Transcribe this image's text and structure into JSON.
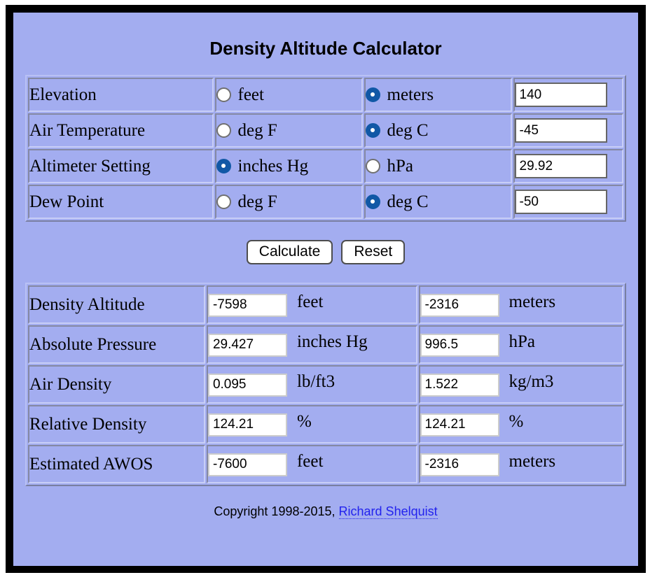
{
  "page": {
    "title": "Density Altitude Calculator",
    "background_color": "#a3adf0",
    "frame_color": "#000000",
    "accent_color": "#1158a6",
    "link_color": "#2222ee"
  },
  "inputs": {
    "rows": [
      {
        "label": "Elevation",
        "option_a": {
          "label": "feet",
          "selected": false
        },
        "option_b": {
          "label": "meters",
          "selected": true
        },
        "value": "140"
      },
      {
        "label": "Air Temperature",
        "option_a": {
          "label": "deg F",
          "selected": false
        },
        "option_b": {
          "label": "deg C",
          "selected": true
        },
        "value": "-45"
      },
      {
        "label": "Altimeter Setting",
        "option_a": {
          "label": "inches Hg",
          "selected": true
        },
        "option_b": {
          "label": "hPa",
          "selected": false
        },
        "value": "29.92"
      },
      {
        "label": "Dew Point",
        "option_a": {
          "label": "deg F",
          "selected": false
        },
        "option_b": {
          "label": "deg C",
          "selected": true
        },
        "value": "-50"
      }
    ]
  },
  "buttons": {
    "calculate": "Calculate",
    "reset": "Reset"
  },
  "results": {
    "rows": [
      {
        "label": "Density Altitude",
        "left_value": "-7598",
        "left_unit": "feet",
        "right_value": "-2316",
        "right_unit": "meters"
      },
      {
        "label": "Absolute Pressure",
        "left_value": "29.427",
        "left_unit": "inches Hg",
        "right_value": "996.5",
        "right_unit": "hPa"
      },
      {
        "label": "Air Density",
        "left_value": "0.095",
        "left_unit": "lb/ft3",
        "right_value": "1.522",
        "right_unit": "kg/m3"
      },
      {
        "label": "Relative Density",
        "left_value": "124.21",
        "left_unit": "%",
        "right_value": "124.21",
        "right_unit": "%"
      },
      {
        "label": "Estimated AWOS",
        "left_value": "-7600",
        "left_unit": "feet",
        "right_value": "-2316",
        "right_unit": "meters"
      }
    ]
  },
  "footer": {
    "copyright": "Copyright 1998-2015,",
    "author_link": "Richard Shelquist"
  }
}
